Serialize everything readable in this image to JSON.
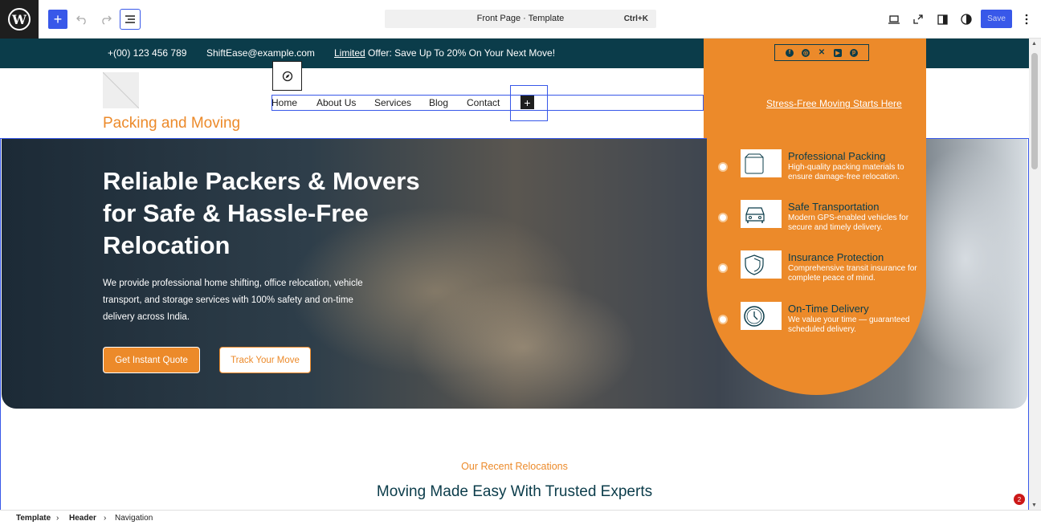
{
  "editor": {
    "document_title": "Front Page · Template",
    "command_shortcut": "Ctrl+K",
    "save_label": "Save",
    "accent_color": "#3858e9"
  },
  "topbar": {
    "phone": "+(00) 123 456 789",
    "email": "ShiftEase@example.com",
    "offer_highlight": "Limited",
    "offer_text": "Offer: Save Up To 20% On Your Next Move!",
    "social_icons": [
      "facebook-icon",
      "instagram-icon",
      "x-icon",
      "youtube-icon",
      "pinterest-icon"
    ]
  },
  "header": {
    "site_title": "Packing and Moving",
    "nav": [
      "Home",
      "About Us",
      "Services",
      "Blog",
      "Contact"
    ],
    "cta_link": "Stress-Free Moving Starts Here"
  },
  "hero": {
    "title": "Reliable Packers & Movers for Safe & Hassle-Free Relocation",
    "description": "We provide professional home shifting, office relocation, vehicle transport, and storage services with 100% safety and on-time delivery across India.",
    "primary_button": "Get Instant Quote",
    "secondary_button": "Track Your Move"
  },
  "features": [
    {
      "title": "Professional Packing",
      "desc": "High-quality packing materials to ensure damage-free relocation.",
      "icon": "box-icon"
    },
    {
      "title": "Safe Transportation",
      "desc": "Modern GPS-enabled vehicles for secure and timely delivery.",
      "icon": "truck-icon"
    },
    {
      "title": "Insurance Protection",
      "desc": "Comprehensive transit insurance for complete peace of mind.",
      "icon": "shield-icon"
    },
    {
      "title": "On-Time Delivery",
      "desc": "We value your time — guaranteed scheduled delivery.",
      "icon": "clock-icon"
    }
  ],
  "recent": {
    "kicker": "Our Recent Relocations",
    "title": "Moving Made Easy With Trusted Experts"
  },
  "breadcrumb": {
    "items": [
      "Template",
      "Header",
      "Navigation"
    ]
  },
  "notifications": {
    "count": "2"
  },
  "colors": {
    "brand_orange": "#ec8a2a",
    "brand_navy": "#0b3c4a"
  }
}
